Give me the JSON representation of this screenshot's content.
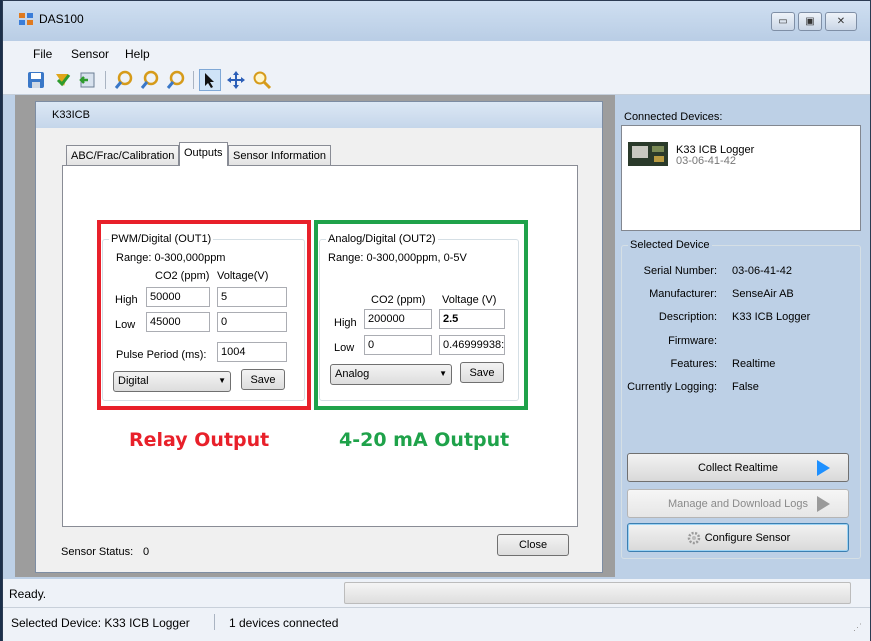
{
  "window": {
    "title": "DAS100",
    "minimize": "▭",
    "maximize": "▣",
    "close": "✕"
  },
  "menu": [
    "File",
    "Sensor",
    "Help"
  ],
  "child_window": {
    "title": "K33ICB"
  },
  "tabs": [
    "ABC/Frac/Calibration",
    "Outputs",
    "Sensor Information"
  ],
  "out1": {
    "legend": "PWM/Digital (OUT1)",
    "range": "Range: 0-300,000ppm",
    "col_co2": "CO2 (ppm)",
    "col_volt": "Voltage(V)",
    "high_label": "High",
    "high_co2": "50000",
    "high_volt": "5",
    "low_label": "Low",
    "low_co2": "45000",
    "low_volt": "0",
    "pulse_label": "Pulse Period (ms):",
    "pulse_value": "1004",
    "mode": "Digital",
    "save": "Save"
  },
  "out2": {
    "legend": "Analog/Digital (OUT2)",
    "range": "Range: 0-300,000ppm, 0-5V",
    "col_co2": "CO2 (ppm)",
    "col_volt": "Voltage (V)",
    "high_label": "High",
    "high_co2": "200000",
    "high_volt": "2.5",
    "low_label": "Low",
    "low_co2": "0",
    "low_volt": "0.46999938:",
    "mode": "Analog",
    "save": "Save"
  },
  "annotations": {
    "relay": "Relay Output",
    "current": "4-20 mA Output",
    "relay_color": "#e8202a",
    "current_color": "#1fa24a"
  },
  "sensor_status": {
    "label": "Sensor Status:",
    "value": "0"
  },
  "close_button": "Close",
  "connected": {
    "label": "Connected Devices:",
    "device_name": "K33 ICB Logger",
    "device_serial": "03-06-41-42"
  },
  "selected_device": {
    "legend": "Selected Device",
    "fields": [
      {
        "label": "Serial Number:",
        "value": "03-06-41-42"
      },
      {
        "label": "Manufacturer:",
        "value": "SenseAir AB"
      },
      {
        "label": "Description:",
        "value": "K33 ICB Logger"
      },
      {
        "label": "Firmware:",
        "value": ""
      },
      {
        "label": "Features:",
        "value": "Realtime"
      },
      {
        "label": "Currently Logging:",
        "value": "False"
      }
    ]
  },
  "buttons": {
    "collect": "Collect Realtime",
    "manage": "Manage and Download Logs",
    "configure": "Configure Sensor"
  },
  "status": {
    "ready": "Ready.",
    "selected": "Selected Device: K33 ICB Logger",
    "count": "1 devices connected"
  }
}
